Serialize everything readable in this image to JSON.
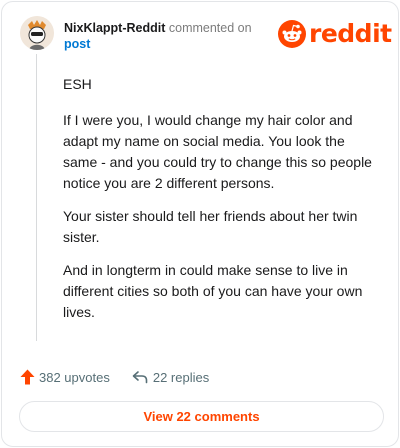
{
  "header": {
    "username": "NixKlappt-Reddit",
    "commented_text": "commented on",
    "post_link": "post",
    "logo_text": "reddit"
  },
  "comment": {
    "paragraphs": [
      "ESH",
      "If I were you, I would change my hair color and adapt my name on social media. You look the same - and you could try to change this so people notice you are 2 different persons.",
      "Your sister should tell her friends about her twin sister.",
      "And in longterm in could make sense to live in different cities so both of you can have your own lives."
    ]
  },
  "actions": {
    "upvotes": "382 upvotes",
    "replies": "22 replies"
  },
  "view_button": "View 22 comments",
  "colors": {
    "brand": "#ff4500",
    "link": "#0079d3",
    "muted": "#7c7c7c"
  }
}
